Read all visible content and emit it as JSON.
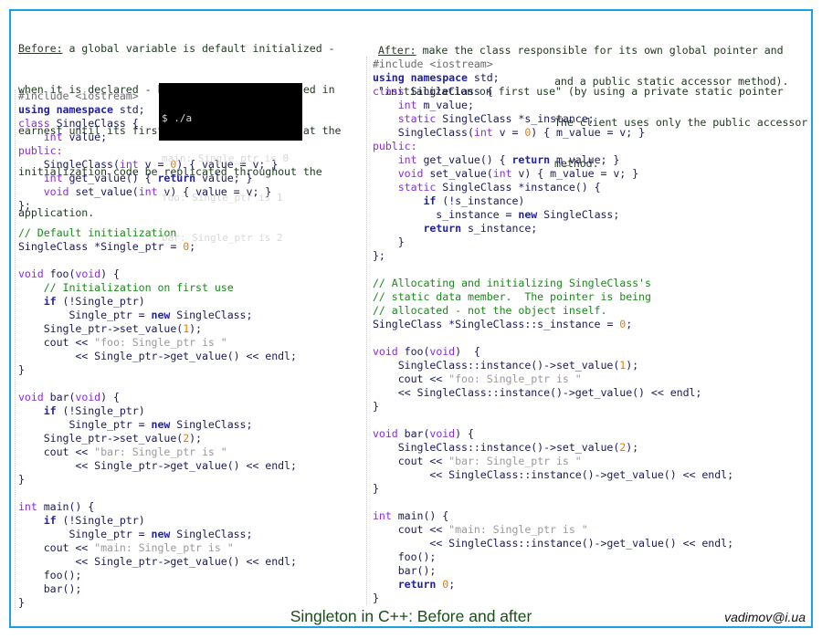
{
  "title": "Singleton in C++: Before and after",
  "author": "vadimov@i.ua",
  "colors": {
    "frame": "#1ba1e2",
    "keyword": "#1f1fa8",
    "type": "#8a2be2",
    "number": "#f07800",
    "string": "#9a9a9a",
    "comment": "#1a8a1a",
    "preprocessor": "#6b6b6b",
    "text": "#1a1a5c",
    "terminal_bg": "#000000"
  },
  "before": {
    "heading": "Before:",
    "description": [
      " a global variable is default initialized -",
      "when it is declared - but it is not initialized in",
      "earnest until its first use. This requires that the",
      "initialization code be replicated throughout the",
      "application."
    ],
    "terminal": [
      "$ ./a",
      "main: Single_ptr is 0",
      "foo: Single_ptr is 1",
      "bar: Single_ptr is 2"
    ],
    "code": [
      [
        [
          "pp",
          "#include <iostream>"
        ]
      ],
      [
        [
          "kw",
          "using namespace"
        ],
        [
          "tx",
          " std;"
        ]
      ],
      [
        [
          "ty",
          "class"
        ],
        [
          "tx",
          " SingleClass {"
        ]
      ],
      [
        [
          "tx",
          "    "
        ],
        [
          "ty",
          "int"
        ],
        [
          "tx",
          " value;"
        ]
      ],
      [
        [
          "ty",
          "public:"
        ]
      ],
      [
        [
          "tx",
          "    SingleClass("
        ],
        [
          "ty",
          "int"
        ],
        [
          "tx",
          " v = "
        ],
        [
          "num",
          "0"
        ],
        [
          "tx",
          ") { value = v; }"
        ]
      ],
      [
        [
          "tx",
          "    "
        ],
        [
          "ty",
          "int"
        ],
        [
          "tx",
          " get_value() { "
        ],
        [
          "kw",
          "return"
        ],
        [
          "tx",
          " value; }"
        ]
      ],
      [
        [
          "tx",
          "    "
        ],
        [
          "ty",
          "void"
        ],
        [
          "tx",
          " set_value("
        ],
        [
          "ty",
          "int"
        ],
        [
          "tx",
          " v) { value = v; }"
        ]
      ],
      [
        [
          "tx",
          "};"
        ]
      ],
      [
        [
          "tx",
          ""
        ]
      ],
      [
        [
          "cm",
          "// Default initialization"
        ]
      ],
      [
        [
          "tx",
          "SingleClass *Single_ptr = "
        ],
        [
          "num",
          "0"
        ],
        [
          "tx",
          ";"
        ]
      ],
      [
        [
          "tx",
          ""
        ]
      ],
      [
        [
          "ty",
          "void"
        ],
        [
          "tx",
          " foo("
        ],
        [
          "ty",
          "void"
        ],
        [
          "tx",
          ") {"
        ]
      ],
      [
        [
          "cm",
          "    // Initialization on first use"
        ]
      ],
      [
        [
          "tx",
          "    "
        ],
        [
          "kw",
          "if"
        ],
        [
          "tx",
          " (!Single_ptr)"
        ]
      ],
      [
        [
          "tx",
          "        Single_ptr = "
        ],
        [
          "kw",
          "new"
        ],
        [
          "tx",
          " SingleClass;"
        ]
      ],
      [
        [
          "tx",
          "    Single_ptr->set_value("
        ],
        [
          "num",
          "1"
        ],
        [
          "tx",
          ");"
        ]
      ],
      [
        [
          "tx",
          "    cout << "
        ],
        [
          "str",
          "\"foo: Single_ptr is \""
        ]
      ],
      [
        [
          "tx",
          "         << Single_ptr->get_value() << endl;"
        ]
      ],
      [
        [
          "tx",
          "}"
        ]
      ],
      [
        [
          "tx",
          ""
        ]
      ],
      [
        [
          "ty",
          "void"
        ],
        [
          "tx",
          " bar("
        ],
        [
          "ty",
          "void"
        ],
        [
          "tx",
          ") {"
        ]
      ],
      [
        [
          "tx",
          "    "
        ],
        [
          "kw",
          "if"
        ],
        [
          "tx",
          " (!Single_ptr)"
        ]
      ],
      [
        [
          "tx",
          "        Single_ptr = "
        ],
        [
          "kw",
          "new"
        ],
        [
          "tx",
          " SingleClass;"
        ]
      ],
      [
        [
          "tx",
          "    Single_ptr->set_value("
        ],
        [
          "num",
          "2"
        ],
        [
          "tx",
          ");"
        ]
      ],
      [
        [
          "tx",
          "    cout << "
        ],
        [
          "str",
          "\"bar: Single_ptr is \""
        ]
      ],
      [
        [
          "tx",
          "         << Single_ptr->get_value() << endl;"
        ]
      ],
      [
        [
          "tx",
          "}"
        ]
      ],
      [
        [
          "tx",
          ""
        ]
      ],
      [
        [
          "ty",
          "int"
        ],
        [
          "tx",
          " main() {"
        ]
      ],
      [
        [
          "tx",
          "    "
        ],
        [
          "kw",
          "if"
        ],
        [
          "tx",
          " (!Single_ptr)"
        ]
      ],
      [
        [
          "tx",
          "        Single_ptr = "
        ],
        [
          "kw",
          "new"
        ],
        [
          "tx",
          " SingleClass;"
        ]
      ],
      [
        [
          "tx",
          "    cout << "
        ],
        [
          "str",
          "\"main: Single_ptr is \""
        ]
      ],
      [
        [
          "tx",
          "         << Single_ptr->get_value() << endl;"
        ]
      ],
      [
        [
          "tx",
          "    foo();"
        ]
      ],
      [
        [
          "tx",
          "    bar();"
        ]
      ],
      [
        [
          "tx",
          "}"
        ]
      ]
    ]
  },
  "after": {
    "heading": "After:",
    "description_top": [
      " make the class responsible for its own global pointer and",
      "\"initialization on first use\" (by using a private static pointer"
    ],
    "description_side": [
      "and a public static accessor method).",
      "The client uses only the public accessor",
      "method."
    ],
    "code": [
      [
        [
          "pp",
          "#include <iostream>"
        ]
      ],
      [
        [
          "kw",
          "using namespace"
        ],
        [
          "tx",
          " std;"
        ]
      ],
      [
        [
          "ty",
          "class"
        ],
        [
          "tx",
          " SingleClass {"
        ]
      ],
      [
        [
          "tx",
          "    "
        ],
        [
          "ty",
          "int"
        ],
        [
          "tx",
          " m_value;"
        ]
      ],
      [
        [
          "tx",
          "    "
        ],
        [
          "ty",
          "static"
        ],
        [
          "tx",
          " SingleClass *s_instance;"
        ]
      ],
      [
        [
          "tx",
          "    SingleClass("
        ],
        [
          "ty",
          "int"
        ],
        [
          "tx",
          " v = "
        ],
        [
          "num",
          "0"
        ],
        [
          "tx",
          ") { m_value = v; }"
        ]
      ],
      [
        [
          "ty",
          "public:"
        ]
      ],
      [
        [
          "tx",
          "    "
        ],
        [
          "ty",
          "int"
        ],
        [
          "tx",
          " get_value() { "
        ],
        [
          "kw",
          "return"
        ],
        [
          "tx",
          " m_value; }"
        ]
      ],
      [
        [
          "tx",
          "    "
        ],
        [
          "ty",
          "void"
        ],
        [
          "tx",
          " set_value("
        ],
        [
          "ty",
          "int"
        ],
        [
          "tx",
          " v) { m_value = v; }"
        ]
      ],
      [
        [
          "tx",
          "    "
        ],
        [
          "ty",
          "static"
        ],
        [
          "tx",
          " SingleClass *instance() {"
        ]
      ],
      [
        [
          "tx",
          "        "
        ],
        [
          "kw",
          "if"
        ],
        [
          "tx",
          " (!s_instance)"
        ]
      ],
      [
        [
          "tx",
          "          s_instance = "
        ],
        [
          "kw",
          "new"
        ],
        [
          "tx",
          " SingleClass;"
        ]
      ],
      [
        [
          "tx",
          "        "
        ],
        [
          "kw",
          "return"
        ],
        [
          "tx",
          " s_instance;"
        ]
      ],
      [
        [
          "tx",
          "    }"
        ]
      ],
      [
        [
          "tx",
          "};"
        ]
      ],
      [
        [
          "tx",
          ""
        ]
      ],
      [
        [
          "cm",
          "// Allocating and initializing SingleClass's"
        ]
      ],
      [
        [
          "cm",
          "// static data member.  The pointer is being"
        ]
      ],
      [
        [
          "cm",
          "// allocated - not the object inself."
        ]
      ],
      [
        [
          "tx",
          "SingleClass *SingleClass::s_instance = "
        ],
        [
          "num",
          "0"
        ],
        [
          "tx",
          ";"
        ]
      ],
      [
        [
          "tx",
          ""
        ]
      ],
      [
        [
          "ty",
          "void"
        ],
        [
          "tx",
          " foo("
        ],
        [
          "ty",
          "void"
        ],
        [
          "tx",
          ")  {"
        ]
      ],
      [
        [
          "tx",
          "    SingleClass::instance()->set_value("
        ],
        [
          "num",
          "1"
        ],
        [
          "tx",
          ");"
        ]
      ],
      [
        [
          "tx",
          "    cout << "
        ],
        [
          "str",
          "\"foo: Single_ptr is \""
        ]
      ],
      [
        [
          "tx",
          "    << SingleClass::instance()->get_value() << endl;"
        ]
      ],
      [
        [
          "tx",
          "}"
        ]
      ],
      [
        [
          "tx",
          ""
        ]
      ],
      [
        [
          "ty",
          "void"
        ],
        [
          "tx",
          " bar("
        ],
        [
          "ty",
          "void"
        ],
        [
          "tx",
          ") {"
        ]
      ],
      [
        [
          "tx",
          "    SingleClass::instance()->set_value("
        ],
        [
          "num",
          "2"
        ],
        [
          "tx",
          ");"
        ]
      ],
      [
        [
          "tx",
          "    cout << "
        ],
        [
          "str",
          "\"bar: Single_ptr is \""
        ]
      ],
      [
        [
          "tx",
          "         << SingleClass::instance()->get_value() << endl;"
        ]
      ],
      [
        [
          "tx",
          "}"
        ]
      ],
      [
        [
          "tx",
          ""
        ]
      ],
      [
        [
          "ty",
          "int"
        ],
        [
          "tx",
          " main() {"
        ]
      ],
      [
        [
          "tx",
          "    cout << "
        ],
        [
          "str",
          "\"main: Single_ptr is \""
        ]
      ],
      [
        [
          "tx",
          "         << SingleClass::instance()->get_value() << endl;"
        ]
      ],
      [
        [
          "tx",
          "    foo();"
        ]
      ],
      [
        [
          "tx",
          "    bar();"
        ]
      ],
      [
        [
          "tx",
          "    "
        ],
        [
          "kw",
          "return"
        ],
        [
          "tx",
          " "
        ],
        [
          "num",
          "0"
        ],
        [
          "tx",
          ";"
        ]
      ],
      [
        [
          "tx",
          "}"
        ]
      ]
    ]
  }
}
